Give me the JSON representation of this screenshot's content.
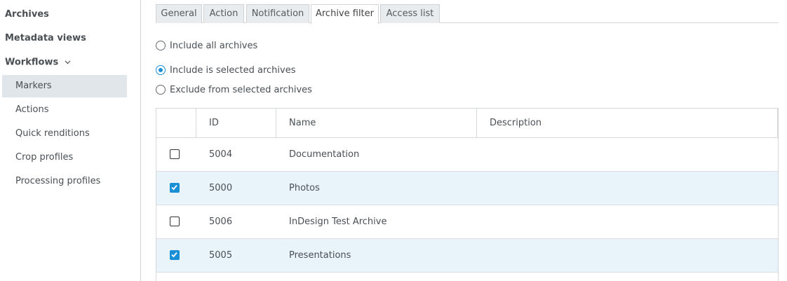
{
  "sidebar": {
    "top_items": [
      {
        "label": "Archives"
      },
      {
        "label": "Metadata views"
      },
      {
        "label": "Workflows"
      }
    ],
    "sub_items": [
      {
        "label": "Markers",
        "active": true
      },
      {
        "label": "Actions"
      },
      {
        "label": "Quick renditions"
      },
      {
        "label": "Crop profiles"
      },
      {
        "label": "Processing profiles"
      }
    ]
  },
  "tabs": [
    {
      "label": "General"
    },
    {
      "label": "Action"
    },
    {
      "label": "Notification"
    },
    {
      "label": "Archive filter",
      "active": true
    },
    {
      "label": "Access list"
    }
  ],
  "filter_options": [
    {
      "label": "Include all archives",
      "checked": false
    },
    {
      "label": "Include is selected archives",
      "checked": true
    },
    {
      "label": "Exclude from selected archives",
      "checked": false
    }
  ],
  "table": {
    "columns": {
      "id": "ID",
      "name": "Name",
      "description": "Description"
    },
    "rows": [
      {
        "checked": false,
        "id": "5004",
        "name": "Documentation",
        "description": ""
      },
      {
        "checked": true,
        "id": "5000",
        "name": "Photos",
        "description": ""
      },
      {
        "checked": false,
        "id": "5006",
        "name": "InDesign Test Archive",
        "description": ""
      },
      {
        "checked": true,
        "id": "5005",
        "name": "Presentations",
        "description": ""
      }
    ]
  },
  "colors": {
    "accent": "#1a8fd6",
    "selected_row": "#e8f3fa",
    "active_nav": "#e1e6ea"
  }
}
